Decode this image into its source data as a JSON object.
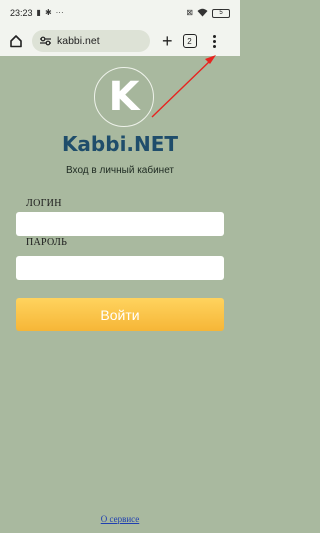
{
  "status_bar": {
    "time": "23:23",
    "battery": "5"
  },
  "browser": {
    "url": "kabbi.net",
    "tab_count": "2"
  },
  "page": {
    "logo_letter": "K",
    "brand": "Kabbi.NET",
    "subtitle": "Вход в личный кабинет",
    "login_label": "ЛОГИН",
    "login_value": "",
    "password_label": "ПАРОЛЬ",
    "password_value": "",
    "submit_label": "Войти",
    "about_link": "О сервисе"
  },
  "icons": {
    "home": "home-icon",
    "site_settings": "tune-icon",
    "new_tab": "plus-icon",
    "tabs": "tabs-icon",
    "menu": "kebab-menu-icon"
  },
  "colors": {
    "page_background": "#a9b99f",
    "brand_text": "#1f4d6b",
    "button": "#f6b637",
    "annotation_arrow": "#e8231f"
  }
}
